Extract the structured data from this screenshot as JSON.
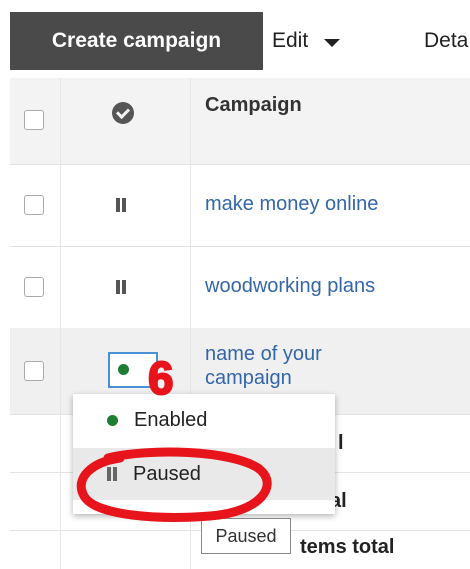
{
  "toolbar": {
    "create_label": "Create campaign",
    "edit_label": "Edit",
    "details_label": "Deta"
  },
  "table": {
    "header": {
      "campaign_col": "Campaign"
    },
    "rows": [
      {
        "name": "make money online",
        "status": "paused"
      },
      {
        "name": "woodworking plans",
        "status": "paused"
      },
      {
        "name": "name of your campaign",
        "status": "enabled"
      }
    ],
    "totals": [
      {
        "text": "l"
      },
      {
        "text": "al"
      },
      {
        "text": "tems total"
      }
    ]
  },
  "dropdown": {
    "items": [
      {
        "label": "Enabled",
        "icon": "green-dot-icon"
      },
      {
        "label": "Paused",
        "icon": "pause-icon"
      }
    ]
  },
  "tooltip": {
    "text": "Paused"
  },
  "annotation": {
    "number": "6",
    "color": "#e8141c"
  },
  "colors": {
    "enabled": "#1e7d32",
    "link": "#3366aa",
    "toolbar_dark": "#4a4a4a",
    "focus": "#4a90d9"
  }
}
